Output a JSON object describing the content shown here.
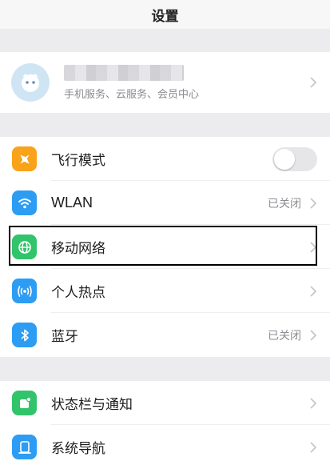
{
  "header": {
    "title": "设置"
  },
  "account": {
    "subtitle": "手机服务、云服务、会员中心"
  },
  "settings_group1": [
    {
      "key": "airplane",
      "label": "飞行模式",
      "icon": "airplane-icon",
      "color": "#f8a319",
      "control": "toggle",
      "enabled": false
    },
    {
      "key": "wlan",
      "label": "WLAN",
      "icon": "wifi-icon",
      "color": "#2d9cf3",
      "status": "已关闭"
    },
    {
      "key": "mobile-network",
      "label": "移动网络",
      "icon": "globe-icon",
      "color": "#31c46b",
      "highlighted": true
    },
    {
      "key": "hotspot",
      "label": "个人热点",
      "icon": "hotspot-icon",
      "color": "#2d9cf3"
    },
    {
      "key": "bluetooth",
      "label": "蓝牙",
      "icon": "bluetooth-icon",
      "color": "#2d9cf3",
      "status": "已关闭"
    }
  ],
  "settings_group2": [
    {
      "key": "status-bar",
      "label": "状态栏与通知",
      "icon": "notification-icon",
      "color": "#31c46b"
    },
    {
      "key": "navigation",
      "label": "系统导航",
      "icon": "navigation-icon",
      "color": "#2d9cf3"
    }
  ]
}
